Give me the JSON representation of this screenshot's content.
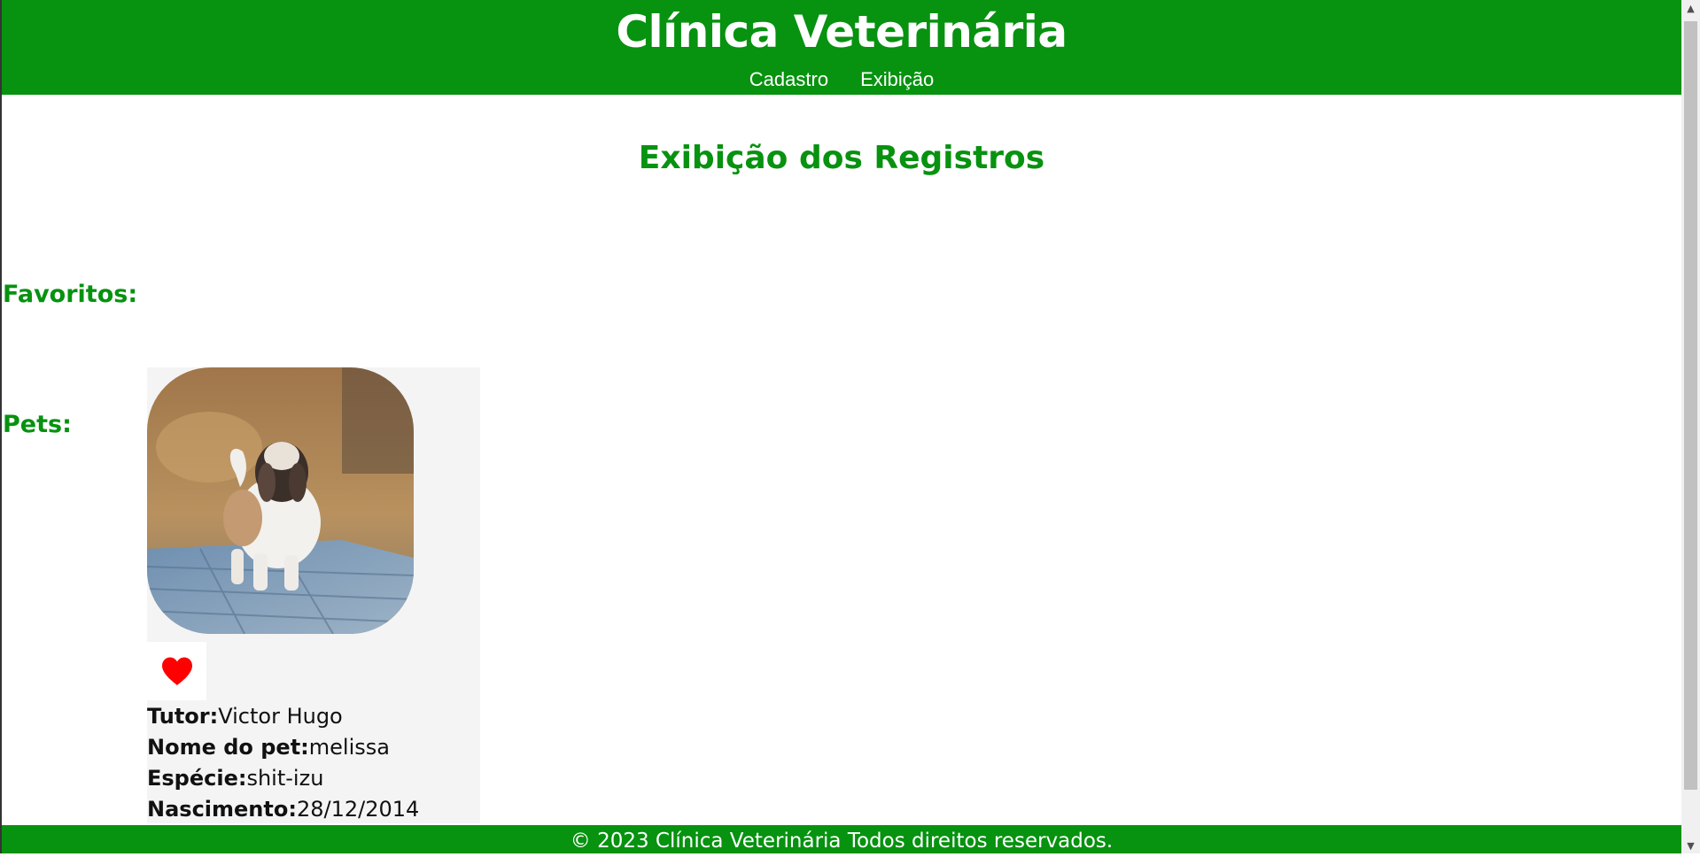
{
  "header": {
    "title": "Clínica Veterinária",
    "nav": [
      {
        "label": "Cadastro"
      },
      {
        "label": "Exibição"
      }
    ]
  },
  "main": {
    "heading": "Exibição dos Registros",
    "favorites_label": "Favoritos:",
    "pets_label": "Pets:",
    "pets": [
      {
        "favorite_icon": "heart-icon",
        "fields": [
          {
            "key": "Tutor:",
            "value": "Victor Hugo"
          },
          {
            "key": "Nome do pet:",
            "value": "melissa"
          },
          {
            "key": "Espécie:",
            "value": "shit-izu"
          },
          {
            "key": "Nascimento:",
            "value": "28/12/2014"
          }
        ]
      }
    ]
  },
  "footer": {
    "text": "© 2023 Clínica Veterinária Todos direitos reservados."
  },
  "colors": {
    "brand_green": "#079210",
    "card_bg": "#f4f4f4",
    "heart": "#ff0000"
  }
}
